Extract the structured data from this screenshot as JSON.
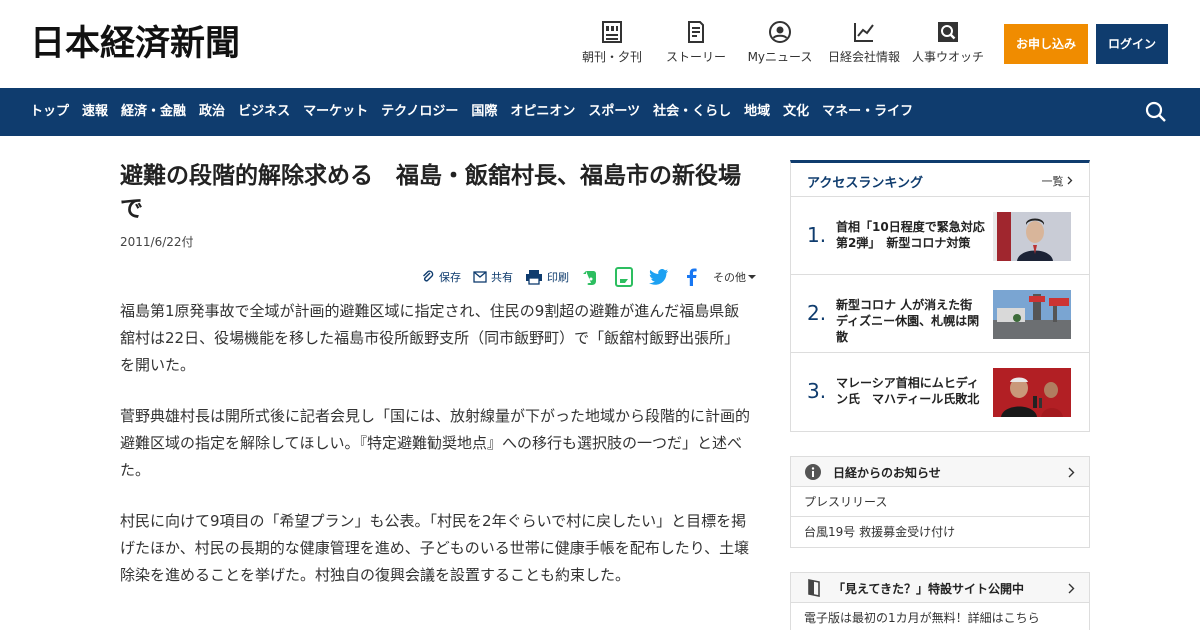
{
  "header": {
    "logo": "日本経済新聞",
    "nav": [
      {
        "label": "朝刊・夕刊",
        "icon": "newspaper-icon"
      },
      {
        "label": "ストーリー",
        "icon": "document-icon"
      },
      {
        "label": "Myニュース",
        "icon": "user-icon"
      },
      {
        "label": "日経会社情報",
        "icon": "chart-icon"
      },
      {
        "label": "人事ウオッチ",
        "icon": "search-person-icon"
      }
    ],
    "subscribe_label": "お申し込み",
    "login_label": "ログイン"
  },
  "navbar": {
    "items": [
      "トップ",
      "速報",
      "経済・金融",
      "政治",
      "ビジネス",
      "マーケット",
      "テクノロジー",
      "国際",
      "オピニオン",
      "スポーツ",
      "社会・くらし",
      "地域",
      "文化",
      "マネー・ライフ"
    ]
  },
  "article": {
    "title": "避難の段階的解除求める　福島・飯舘村長、福島市の新役場で",
    "date": "2011/6/22付",
    "tools": {
      "save": "保存",
      "share": "共有",
      "print": "印刷",
      "more": "その他"
    },
    "paragraphs": [
      "福島第1原発事故で全域が計画的避難区域に指定され、住民の9割超の避難が進んだ福島県飯舘村は22日、役場機能を移した福島市役所飯野支所（同市飯野町）で「飯舘村飯野出張所」を開いた。",
      "菅野典雄村長は開所式後に記者会見し「国には、放射線量が下がった地域から段階的に計画的避難区域の指定を解除してほしい。『特定避難勧奨地点』への移行も選択肢の一つだ」と述べた。",
      "村民に向けて9項目の「希望プラン」も公表。「村民を2年ぐらいで村に戻したい」と目標を掲げたほか、村民の長期的な健康管理を進め、子どものいる世帯に健康手帳を配布したり、土壌除染を進めることを挙げた。村独自の復興会議を設置することも約束した。"
    ]
  },
  "ranking": {
    "title": "アクセスランキング",
    "more": "一覧",
    "items": [
      {
        "num": "1.",
        "text": "首相「10日程度で緊急対応第2弾」　新型コロナ対策"
      },
      {
        "num": "2.",
        "text": "新型コロナ 人が消えた街 ディズニー休園、札幌は閑散"
      },
      {
        "num": "3.",
        "text": "マレーシア首相にムヒディン氏　マハティール氏敗北"
      }
    ]
  },
  "notice": {
    "title": "日経からのお知らせ",
    "rows": [
      "プレスリリース",
      "台風19号 救援募金受け付け"
    ]
  },
  "special": {
    "title": "「見えてきた？」特設サイト公開中",
    "row": "電子版は最初の1カ月が無料！詳細はこちら"
  },
  "colors": {
    "brand_navy": "#0f3c6e",
    "subscribe_orange": "#f08c00"
  }
}
